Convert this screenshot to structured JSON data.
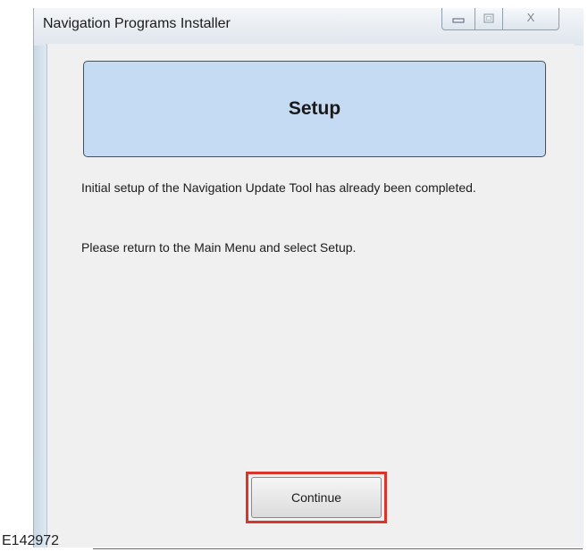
{
  "window": {
    "title": "Navigation Programs Installer",
    "controls": {
      "minimize_icon": "minimize-icon",
      "maximize_icon": "maximize-icon",
      "close_icon": "close-icon",
      "close_glyph": "X"
    }
  },
  "header": {
    "title": "Setup"
  },
  "messages": {
    "line1": "Initial setup of the Navigation Update Tool has already been completed.",
    "line2": "Please return to the Main Menu and select Setup."
  },
  "actions": {
    "continue_label": "Continue"
  },
  "figure": {
    "reference": "E142972"
  },
  "colors": {
    "header_panel": "#c5dbf3",
    "highlight": "#d9362b",
    "client_background": "#f0f0f0"
  }
}
